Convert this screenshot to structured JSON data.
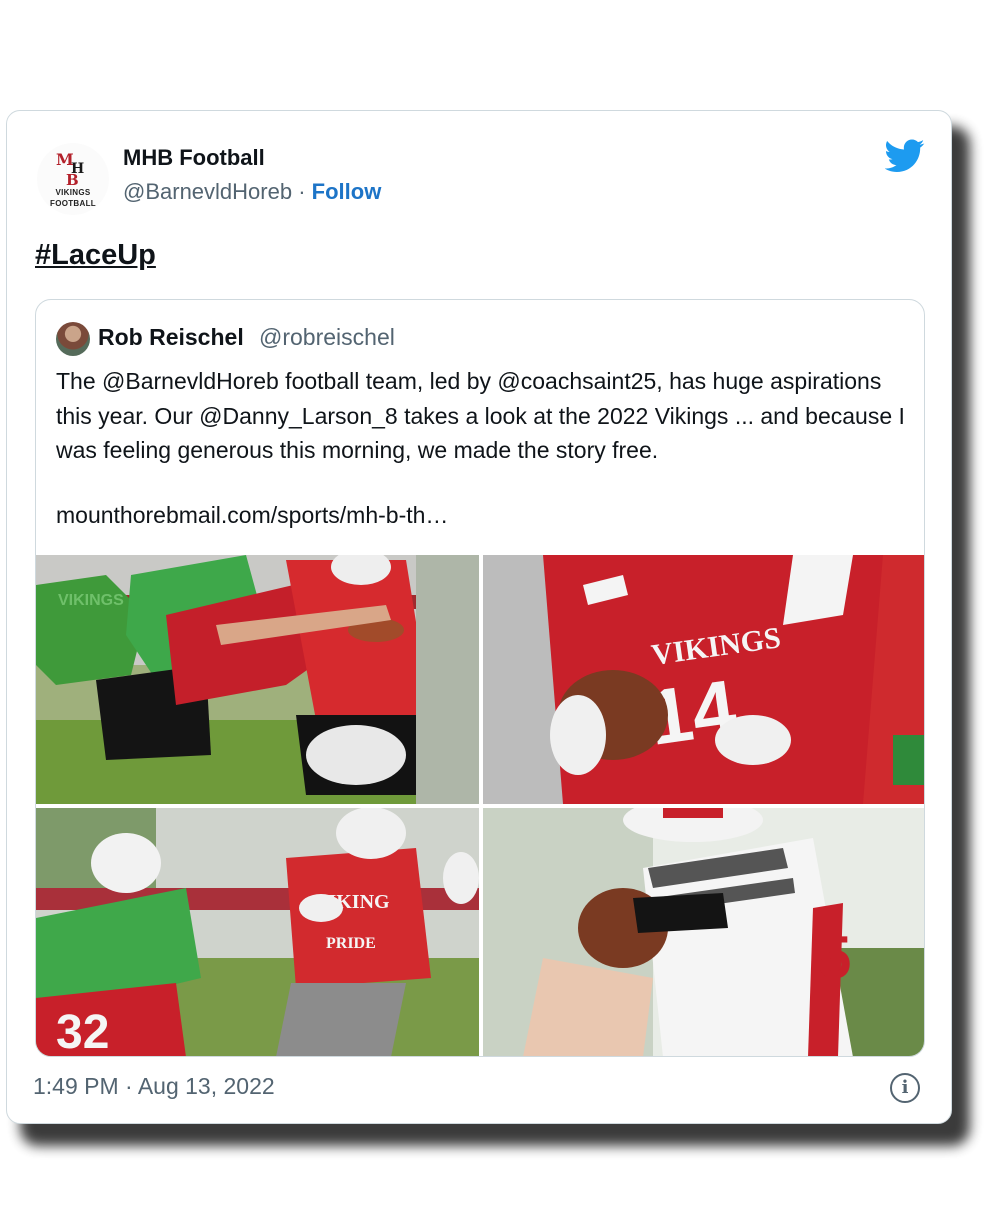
{
  "author": {
    "name": "MHB Football",
    "handle": "@BarnevldHoreb",
    "separator": "·",
    "follow_label": "Follow",
    "avatar": {
      "mark": "MHB",
      "line1": "VIKINGS",
      "line2": "FOOTBALL"
    }
  },
  "platform_icon": "twitter-bird-icon",
  "tweet_text": "#LaceUp",
  "quoted": {
    "name": "Rob Reischel",
    "handle": "@robreischel",
    "text": "The @BarnevldHoreb football team, led by @coachsaint25, has huge aspirations this year. Our @Danny_Larson_8 takes a look at the 2022 Vikings ... and because I was feeling generous this morning, we made the story free.",
    "link": "mounthorebmail.com/sports/mh-b-th…",
    "photos": [
      {
        "jersey_text": "VIKINGS"
      },
      {
        "jersey_text": "VIKINGS",
        "number": "14"
      },
      {
        "jersey_text": "VIKING",
        "jersey_text_2": "PRIDE",
        "number": "32"
      },
      {
        "number": "5"
      }
    ]
  },
  "timestamp": "1:49 PM · Aug 13, 2022",
  "info_icon": "info-icon",
  "colors": {
    "accent": "#1d74c7",
    "bird": "#1d9bf0",
    "team_red": "#c8202a"
  }
}
